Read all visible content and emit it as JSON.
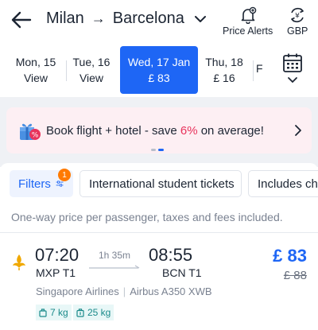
{
  "header": {
    "origin": "Milan",
    "separator": "→",
    "destination": "Barcelona",
    "price_alerts_label": "Price Alerts",
    "currency_label": "GBP"
  },
  "dates": [
    {
      "day": "Mon, 15",
      "sub": "View",
      "active": false
    },
    {
      "day": "Tue, 16",
      "sub": "View",
      "active": false
    },
    {
      "day": "Wed, 17 Jan",
      "sub": "£ 83",
      "active": true
    },
    {
      "day": "Thu, 18",
      "sub": "£ 16",
      "active": false
    },
    {
      "day": "F",
      "sub": "",
      "active": false
    }
  ],
  "promo": {
    "prefix": "Book flight + hotel - save ",
    "percent": "6%",
    "suffix": " on average!"
  },
  "filters": {
    "filters_label": "Filters",
    "badge_count": "1",
    "student_label": "International student tickets",
    "includes_label": "Includes che"
  },
  "note": "One-way price per passenger, taxes and fees included.",
  "flight": {
    "dep_time": "07:20",
    "dep_airport": "MXP T1",
    "duration": "1h 35m",
    "arr_time": "08:55",
    "arr_airport": "BCN T1",
    "price": "£ 83",
    "old_price": "£ 88",
    "airline": "Singapore Airlines",
    "aircraft": "Airbus A350 XWB",
    "bag_cabin": "7 kg",
    "bag_checked": "25 kg"
  },
  "colors": {
    "accent": "#1e66f5",
    "promo_bg": "#fdeff3",
    "promo_highlight": "#e8335c",
    "badge": "#ff7a00",
    "bag_bg": "#e8f7f7",
    "bag_text": "#1a8a8a"
  },
  "icons": [
    "back-arrow-icon",
    "chevron-down-icon",
    "bell-plus-icon",
    "currency-exchange-icon",
    "calendar-icon",
    "gift-icon",
    "chevron-right-icon",
    "sliders-icon",
    "singapore-airlines-logo",
    "cabin-bag-icon",
    "checked-bag-icon"
  ]
}
